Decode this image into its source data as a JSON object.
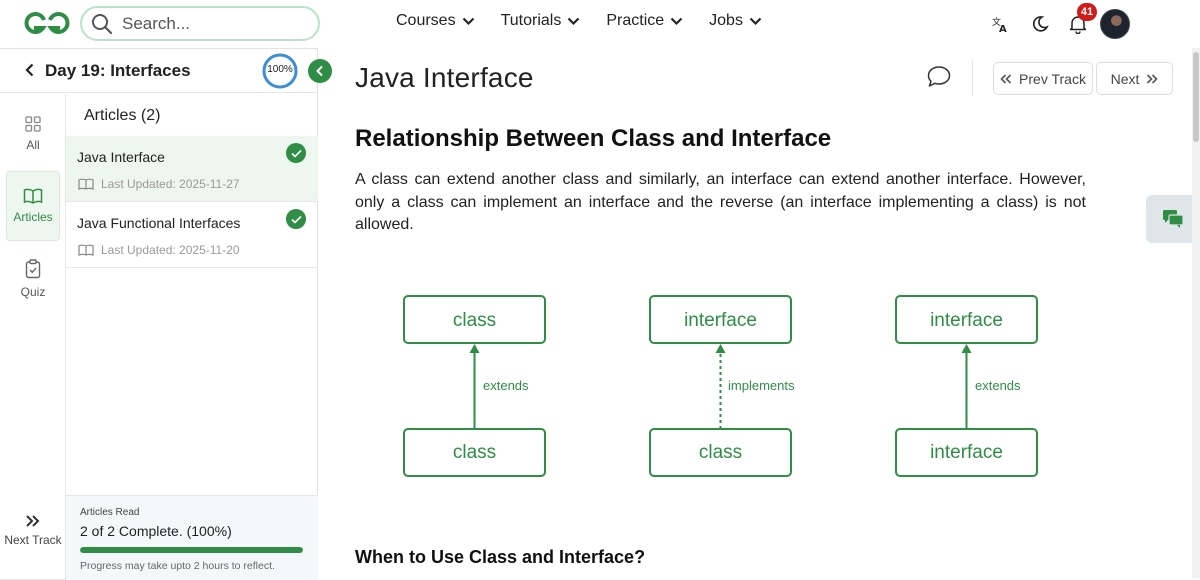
{
  "header": {
    "logo_icon": "gfg-logo-icon",
    "search_placeholder": "Search...",
    "nav": [
      {
        "label": "Courses"
      },
      {
        "label": "Tutorials"
      },
      {
        "label": "Practice"
      },
      {
        "label": "Jobs"
      }
    ],
    "icons": [
      "translate-icon",
      "dark-mode-moon-icon",
      "notification-bell-icon"
    ],
    "notification_count": "41"
  },
  "sidebar": {
    "title": "Day 19: Interfaces",
    "progress_ring": "100%",
    "progress_ring_value": 1.0,
    "tabs": [
      {
        "label": "All",
        "icon": "grid-icon",
        "active": false
      },
      {
        "label": "Articles",
        "icon": "book-icon",
        "active": true
      },
      {
        "label": "Quiz",
        "icon": "clipboard-icon",
        "active": false
      }
    ],
    "next_track": "Next Track",
    "articles_heading": "Articles (2)",
    "articles": [
      {
        "title": "Java Interface",
        "updated": "Last Updated: 2025-11-27",
        "completed": true,
        "active": true
      },
      {
        "title": "Java Functional Interfaces",
        "updated": "Last Updated: 2025-11-20",
        "completed": true,
        "active": false
      }
    ],
    "progress": {
      "label": "Articles Read",
      "value_text": "2 of 2 Complete. (100%)",
      "fraction": 1.0,
      "note": "Progress may take upto 2 hours to reflect."
    }
  },
  "main": {
    "title": "Java Interface",
    "prev_label": "Prev Track",
    "next_label": "Next",
    "section_heading": "Relationship Between Class and Interface",
    "paragraph": "A class can extend another class and similarly, an interface can extend another interface. However, only a class can implement an interface and the reverse (an interface implementing a class) is not allowed.",
    "diagram": [
      {
        "top": "class",
        "bottom": "class",
        "relation": "extends",
        "style": "solid"
      },
      {
        "top": "interface",
        "bottom": "class",
        "relation": "implements",
        "style": "dotted"
      },
      {
        "top": "interface",
        "bottom": "interface",
        "relation": "extends",
        "style": "solid"
      }
    ],
    "sub_heading": "When to Use Class and Interface?"
  },
  "colors": {
    "brand_green": "#2f8d46",
    "active_tab_bg": "#eef6f0",
    "badge_red": "#d11a1a"
  }
}
